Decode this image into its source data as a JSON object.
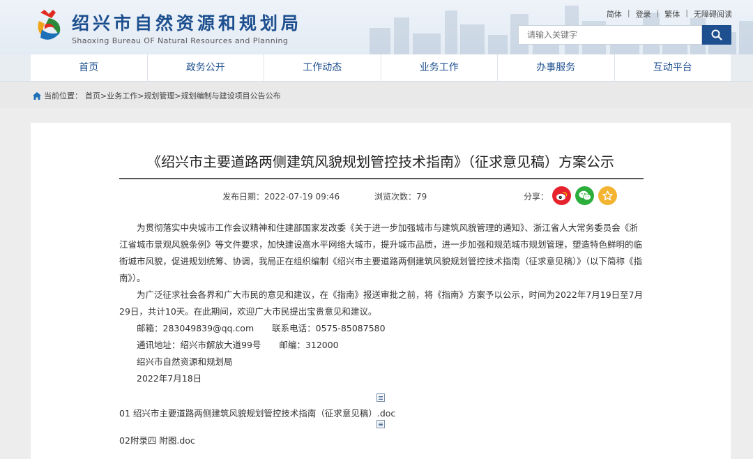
{
  "header": {
    "site_name_cn": "绍兴市自然资源和规划局",
    "site_name_en": "Shaoxing Bureau OF Natural Resources and Planning",
    "links": [
      "简体",
      "登录",
      "繁体",
      "无障碍阅读"
    ],
    "search_placeholder": "请输入关键字"
  },
  "nav": {
    "items": [
      "首页",
      "政务公开",
      "工作动态",
      "业务工作",
      "办事服务",
      "互动平台"
    ]
  },
  "breadcrumb": {
    "prefix": "当前位置：",
    "path": "首页>业务工作>规划管理>规划编制与建设项目公告公布"
  },
  "article": {
    "title": "《绍兴市主要道路两侧建筑风貌规划管控技术指南》（征求意见稿）方案公示",
    "publish_date": "发布日期：2022-07-19 09:46",
    "views": "浏览次数：79",
    "share_label": "分享：",
    "paragraph1": "为贯彻落实中央城市工作会议精神和住建部国家发改委《关于进一步加强城市与建筑风貌管理的通知》、浙江省人大常务委员会《浙江省城市景观风貌条例》等文件要求，加快建设高水平网络大城市，提升城市品质，进一步加强和规范城市规划管理，塑造特色鲜明的临街城市风貌，促进规划统筹、协调，我局正在组织编制《绍兴市主要道路两侧建筑风貌规划管控技术指南（征求意见稿）》（以下简称《指南》）。",
    "paragraph2": "为广泛征求社会各界和广大市民的意见和建议，在《指南》报送审批之前，将《指南》方案予以公示，时间为2022年7月19日至7月29日，共计10天。在此期间，欢迎广大市民提出宝贵意见和建议。",
    "email": "邮箱：283049839@qq.com",
    "phone": "联系电话：0575-85087580",
    "address": "通讯地址：绍兴市解放大道99号",
    "postcode": "邮编：312000",
    "org": "绍兴市自然资源和规划局",
    "date": "2022年7月18日",
    "attachments": [
      "01 绍兴市主要道路两侧建筑风貌规划管控技术指南（征求意见稿）.doc",
      "02附录四 附图.doc"
    ]
  },
  "colors": {
    "brand_blue": "#1d4f8f",
    "weibo": "#e6232d",
    "wechat": "#2bae3c",
    "favorite": "#f3b431"
  }
}
